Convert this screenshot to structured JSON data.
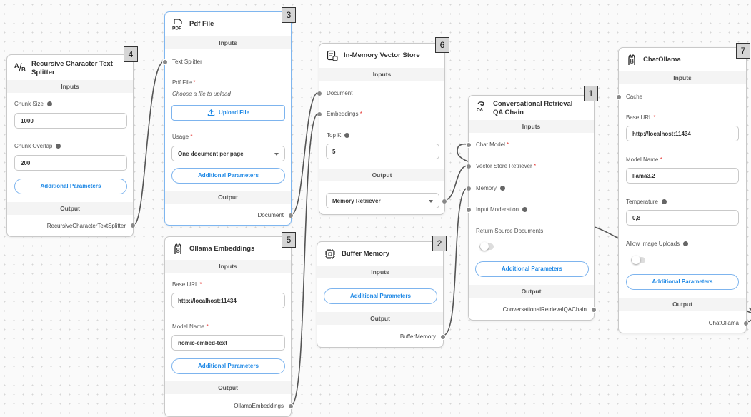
{
  "common": {
    "inputs": "Inputs",
    "output": "Output",
    "additional_parameters": "Additional Parameters"
  },
  "splitter": {
    "title": "Recursive Character Text Splitter",
    "chunk_size_label": "Chunk Size",
    "chunk_size_value": "1000",
    "chunk_overlap_label": "Chunk Overlap",
    "chunk_overlap_value": "200",
    "output_name": "RecursiveCharacterTextSplitter",
    "badge": "4"
  },
  "pdf": {
    "title": "Pdf File",
    "text_splitter_label": "Text Splitter",
    "pdf_file_label": "Pdf File",
    "pdf_hint": "Choose a file to upload",
    "upload_label": "Upload File",
    "usage_label": "Usage",
    "usage_value": "One document per page",
    "output_name": "Document",
    "badge": "3"
  },
  "embeddings": {
    "title": "Ollama Embeddings",
    "base_url_label": "Base URL",
    "base_url_value": "http://localhost:11434",
    "model_name_label": "Model Name",
    "model_name_value": "nomic-embed-text",
    "output_name": "OllamaEmbeddings",
    "badge": "5"
  },
  "vectorstore": {
    "title": "In-Memory Vector Store",
    "document_label": "Document",
    "embeddings_label": "Embeddings",
    "topk_label": "Top K",
    "topk_value": "5",
    "output_value": "Memory Retriever",
    "badge": "6"
  },
  "buffer": {
    "title": "Buffer Memory",
    "output_name": "BufferMemory",
    "badge": "2"
  },
  "chain": {
    "title": "Conversational Retrieval QA Chain",
    "chat_model_label": "Chat Model",
    "retriever_label": "Vector Store Retriever",
    "memory_label": "Memory",
    "moderation_label": "Input Moderation",
    "return_docs_label": "Return Source Documents",
    "return_docs_enabled": false,
    "output_name": "ConversationalRetrievalQAChain",
    "badge": "1"
  },
  "ollama": {
    "title": "ChatOllama",
    "cache_label": "Cache",
    "base_url_label": "Base URL",
    "base_url_value": "http://localhost:11434",
    "model_name_label": "Model Name",
    "model_name_value": "llama3.2",
    "temperature_label": "Temperature",
    "temperature_value": "0,8",
    "image_uploads_label": "Allow Image Uploads",
    "image_uploads_enabled": false,
    "output_name": "ChatOllama",
    "badge": "7"
  },
  "colors": {
    "edge": "#555555",
    "accent": "#1e88e5",
    "required": "#e53935"
  },
  "icons": [
    "text-splitter-icon",
    "pdf-icon",
    "llama-icon",
    "vector-store-icon",
    "memory-chip-icon",
    "chain-icon",
    "upload-icon",
    "info-icon",
    "chevron-down-icon"
  ]
}
